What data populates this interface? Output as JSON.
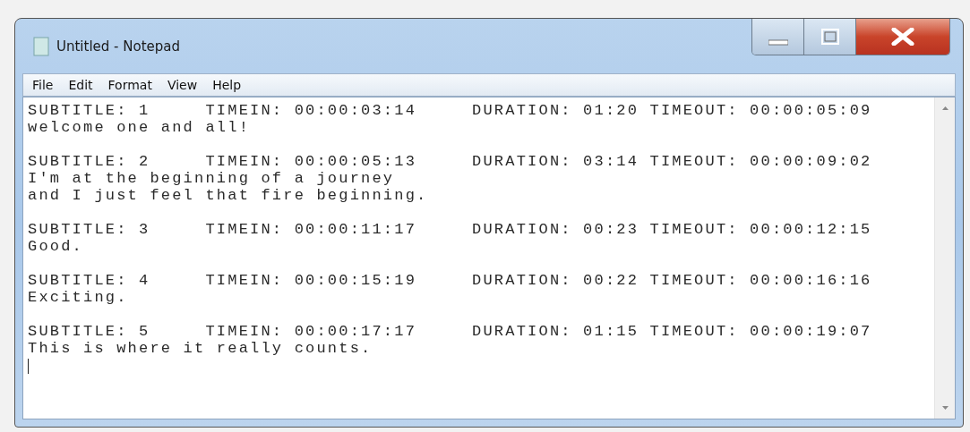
{
  "window": {
    "title": "Untitled - Notepad"
  },
  "menu": [
    "File",
    "Edit",
    "Format",
    "View",
    "Help"
  ],
  "blocks": [
    {
      "header": "SUBTITLE: 1     TIMEIN: 00:00:03:14     DURATION: 01:20 TIMEOUT: 00:00:05:09",
      "text": [
        "welcome one and all!"
      ]
    },
    {
      "header": "SUBTITLE: 2     TIMEIN: 00:00:05:13     DURATION: 03:14 TIMEOUT: 00:00:09:02",
      "text": [
        "I'm at the beginning of a journey",
        "and I just feel that fire beginning."
      ]
    },
    {
      "header": "SUBTITLE: 3     TIMEIN: 00:00:11:17     DURATION: 00:23 TIMEOUT: 00:00:12:15",
      "text": [
        "Good."
      ]
    },
    {
      "header": "SUBTITLE: 4     TIMEIN: 00:00:15:19     DURATION: 00:22 TIMEOUT: 00:00:16:16",
      "text": [
        "Exciting."
      ]
    },
    {
      "header": "SUBTITLE: 5     TIMEIN: 00:00:17:17     DURATION: 01:15 TIMEOUT: 00:00:19:07",
      "text": [
        "This is where it really counts."
      ]
    }
  ]
}
